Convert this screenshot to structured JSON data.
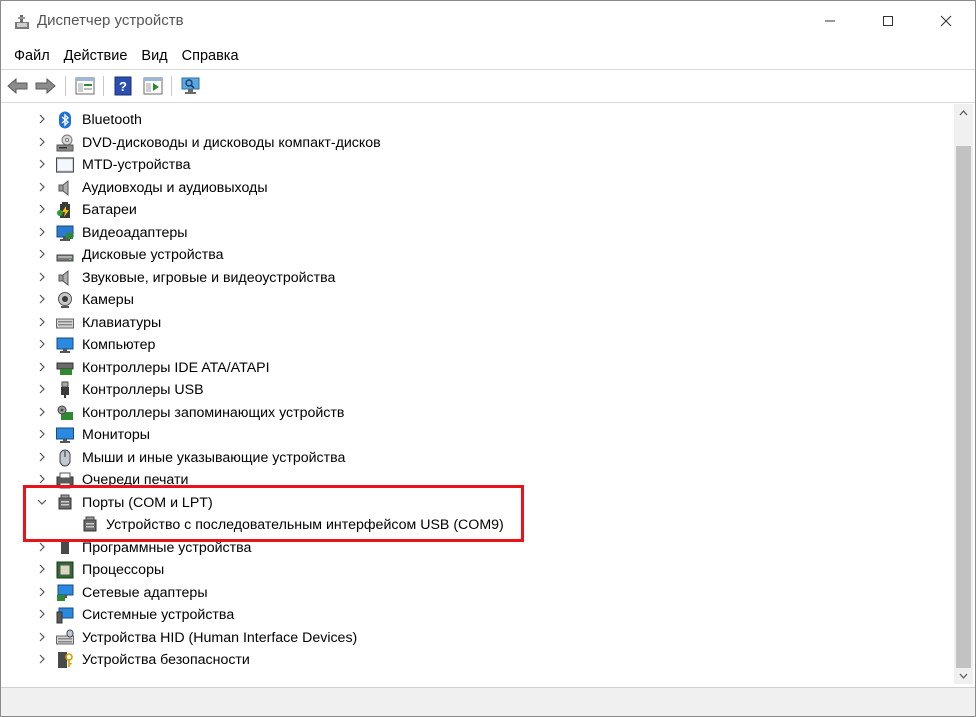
{
  "window": {
    "title": "Диспетчер устройств"
  },
  "menu": [
    "Файл",
    "Действие",
    "Вид",
    "Справка"
  ],
  "toolbar": {
    "icons": [
      "back-arrow-icon",
      "forward-arrow-icon",
      "properties-icon",
      "help-icon",
      "update-driver-icon",
      "scan-hardware-icon"
    ]
  },
  "tree": [
    {
      "label": "Bluetooth",
      "icon": "bluetooth-icon",
      "expanded": false
    },
    {
      "label": "DVD-дисководы и дисководы компакт-дисков",
      "icon": "dvd-drive-icon",
      "expanded": false
    },
    {
      "label": "MTD-устройства",
      "icon": "mtd-device-icon",
      "expanded": false
    },
    {
      "label": "Аудиовходы и аудиовыходы",
      "icon": "audio-io-icon",
      "expanded": false
    },
    {
      "label": "Батареи",
      "icon": "battery-icon",
      "expanded": false
    },
    {
      "label": "Видеоадаптеры",
      "icon": "display-adapter-icon",
      "expanded": false
    },
    {
      "label": "Дисковые устройства",
      "icon": "disk-drive-icon",
      "expanded": false
    },
    {
      "label": "Звуковые, игровые и видеоустройства",
      "icon": "sound-device-icon",
      "expanded": false
    },
    {
      "label": "Камеры",
      "icon": "camera-icon",
      "expanded": false
    },
    {
      "label": "Клавиатуры",
      "icon": "keyboard-icon",
      "expanded": false
    },
    {
      "label": "Компьютер",
      "icon": "computer-icon",
      "expanded": false
    },
    {
      "label": "Контроллеры IDE ATA/ATAPI",
      "icon": "ide-controller-icon",
      "expanded": false
    },
    {
      "label": "Контроллеры USB",
      "icon": "usb-controller-icon",
      "expanded": false
    },
    {
      "label": "Контроллеры запоминающих устройств",
      "icon": "storage-controller-icon",
      "expanded": false
    },
    {
      "label": "Мониторы",
      "icon": "monitor-icon",
      "expanded": false
    },
    {
      "label": "Мыши и иные указывающие устройства",
      "icon": "mouse-icon",
      "expanded": false
    },
    {
      "label": "Очереди печати",
      "icon": "print-queue-icon",
      "expanded": false
    },
    {
      "label": "Порты (COM и LPT)",
      "icon": "port-icon",
      "expanded": true
    },
    {
      "label": "Устройство с последовательным интерфейсом USB (COM9)",
      "icon": "port-icon",
      "child": true
    },
    {
      "label": "Программные устройства",
      "icon": "software-device-icon",
      "expanded": false
    },
    {
      "label": "Процессоры",
      "icon": "processor-icon",
      "expanded": false
    },
    {
      "label": "Сетевые адаптеры",
      "icon": "network-adapter-icon",
      "expanded": false
    },
    {
      "label": "Системные устройства",
      "icon": "system-device-icon",
      "expanded": false
    },
    {
      "label": "Устройства HID (Human Interface Devices)",
      "icon": "hid-device-icon",
      "expanded": false
    },
    {
      "label": "Устройства безопасности",
      "icon": "security-device-icon",
      "expanded": false
    }
  ],
  "highlight_color": "#e8141c"
}
